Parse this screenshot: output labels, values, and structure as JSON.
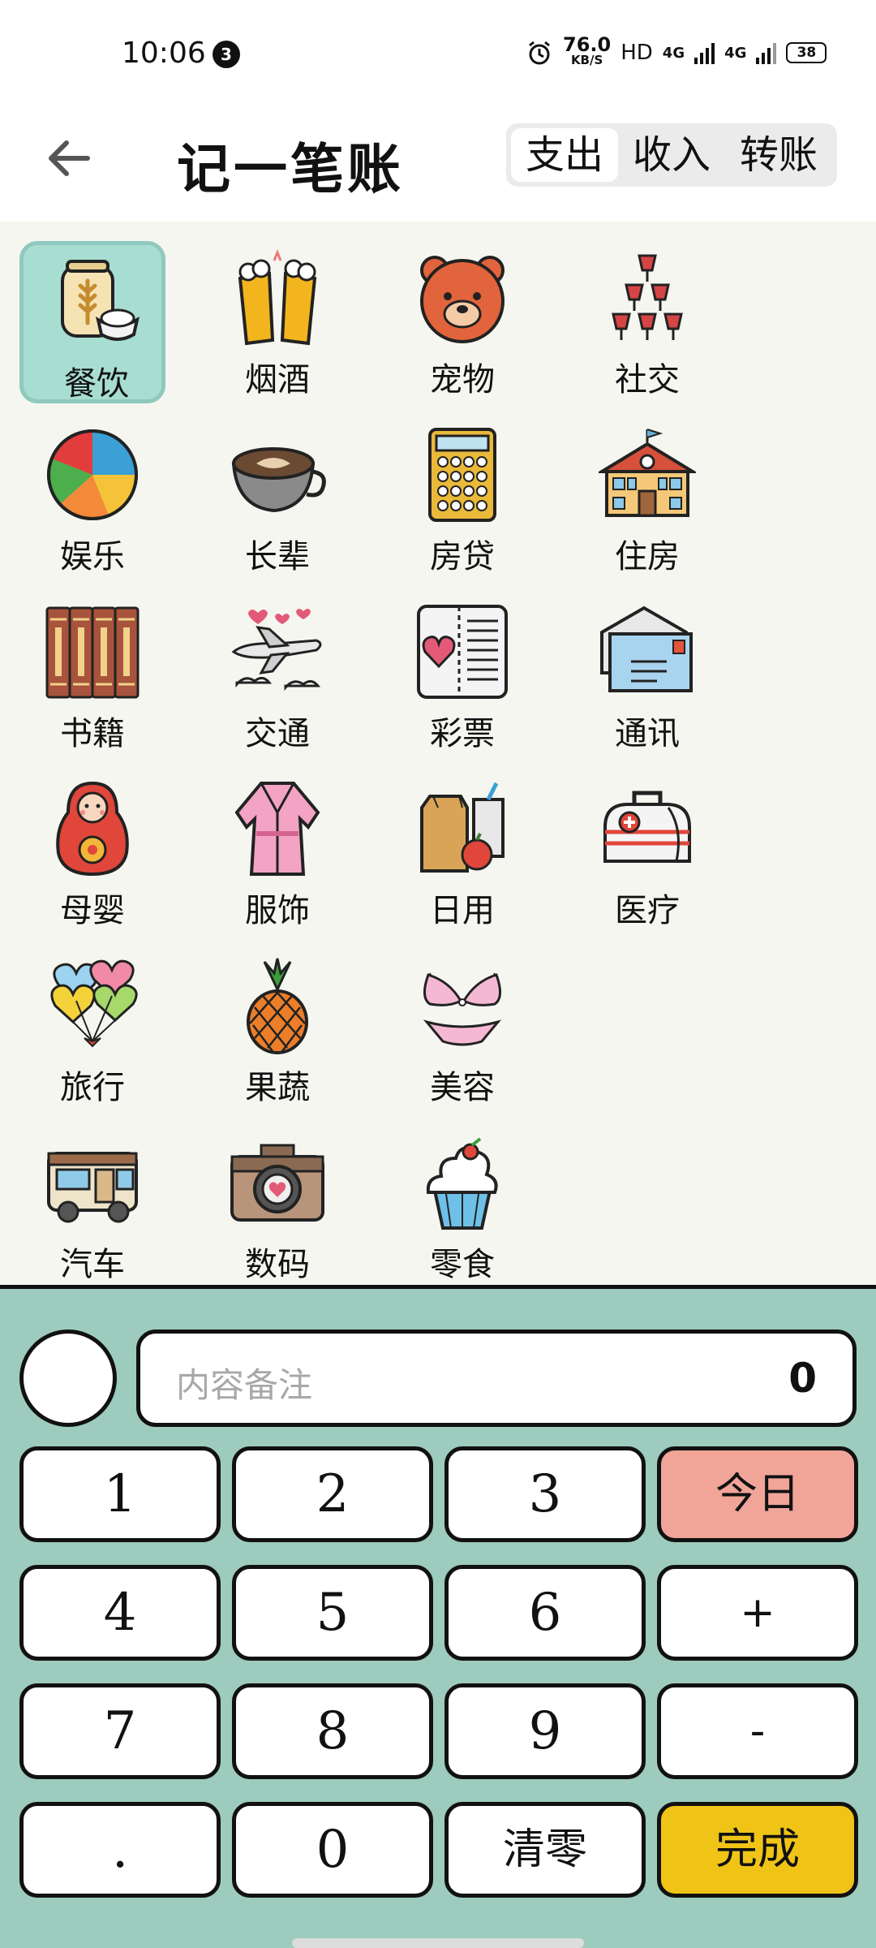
{
  "status_bar": {
    "time": "10:06",
    "notification_count": "3",
    "net_speed": "76.0",
    "net_speed_unit": "KB/S",
    "hd": "HD",
    "net_1": "4G",
    "net_2": "4G",
    "battery": "38"
  },
  "header": {
    "title": "记一笔账",
    "tabs": [
      {
        "label": "支出",
        "active": true
      },
      {
        "label": "收入",
        "active": false
      },
      {
        "label": "转账",
        "active": false
      }
    ]
  },
  "categories": [
    {
      "label": "餐饮",
      "icon": "grain-bowl-icon",
      "selected": true
    },
    {
      "label": "烟酒",
      "icon": "beer-mugs-icon"
    },
    {
      "label": "宠物",
      "icon": "bear-face-icon"
    },
    {
      "label": "社交",
      "icon": "wine-glasses-icon"
    },
    {
      "label": "娱乐",
      "icon": "beach-ball-icon"
    },
    {
      "label": "长辈",
      "icon": "coffee-cup-icon"
    },
    {
      "label": "房贷",
      "icon": "calculator-icon"
    },
    {
      "label": "住房",
      "icon": "house-icon"
    },
    {
      "label": "书籍",
      "icon": "encyclopedia-books-icon"
    },
    {
      "label": "交通",
      "icon": "airplane-icon"
    },
    {
      "label": "彩票",
      "icon": "lottery-ticket-icon"
    },
    {
      "label": "通讯",
      "icon": "envelope-icon"
    },
    {
      "label": "母婴",
      "icon": "matryoshka-doll-icon"
    },
    {
      "label": "服饰",
      "icon": "bathrobe-icon"
    },
    {
      "label": "日用",
      "icon": "grocery-bag-icon"
    },
    {
      "label": "医疗",
      "icon": "medical-bag-icon"
    },
    {
      "label": "旅行",
      "icon": "heart-balloons-icon"
    },
    {
      "label": "果蔬",
      "icon": "pineapple-icon"
    },
    {
      "label": "美容",
      "icon": "bikini-icon"
    },
    {
      "label": "汽车",
      "icon": "camper-van-icon"
    },
    {
      "label": "数码",
      "icon": "camera-icon"
    },
    {
      "label": "零食",
      "icon": "cupcake-icon"
    }
  ],
  "note": {
    "placeholder": "内容备注",
    "amount": "0"
  },
  "keys": [
    "1",
    "2",
    "3",
    "今日",
    "4",
    "5",
    "6",
    "+",
    "7",
    "8",
    "9",
    "-",
    ".",
    "0",
    "清零",
    "完成"
  ],
  "colors": {
    "grid_bg": "#f6f6f1",
    "pad_bg": "#9dcbbd",
    "selected_bg": "#a8ddd1",
    "today_key": "#f1a599",
    "done_key": "#f0c417"
  }
}
